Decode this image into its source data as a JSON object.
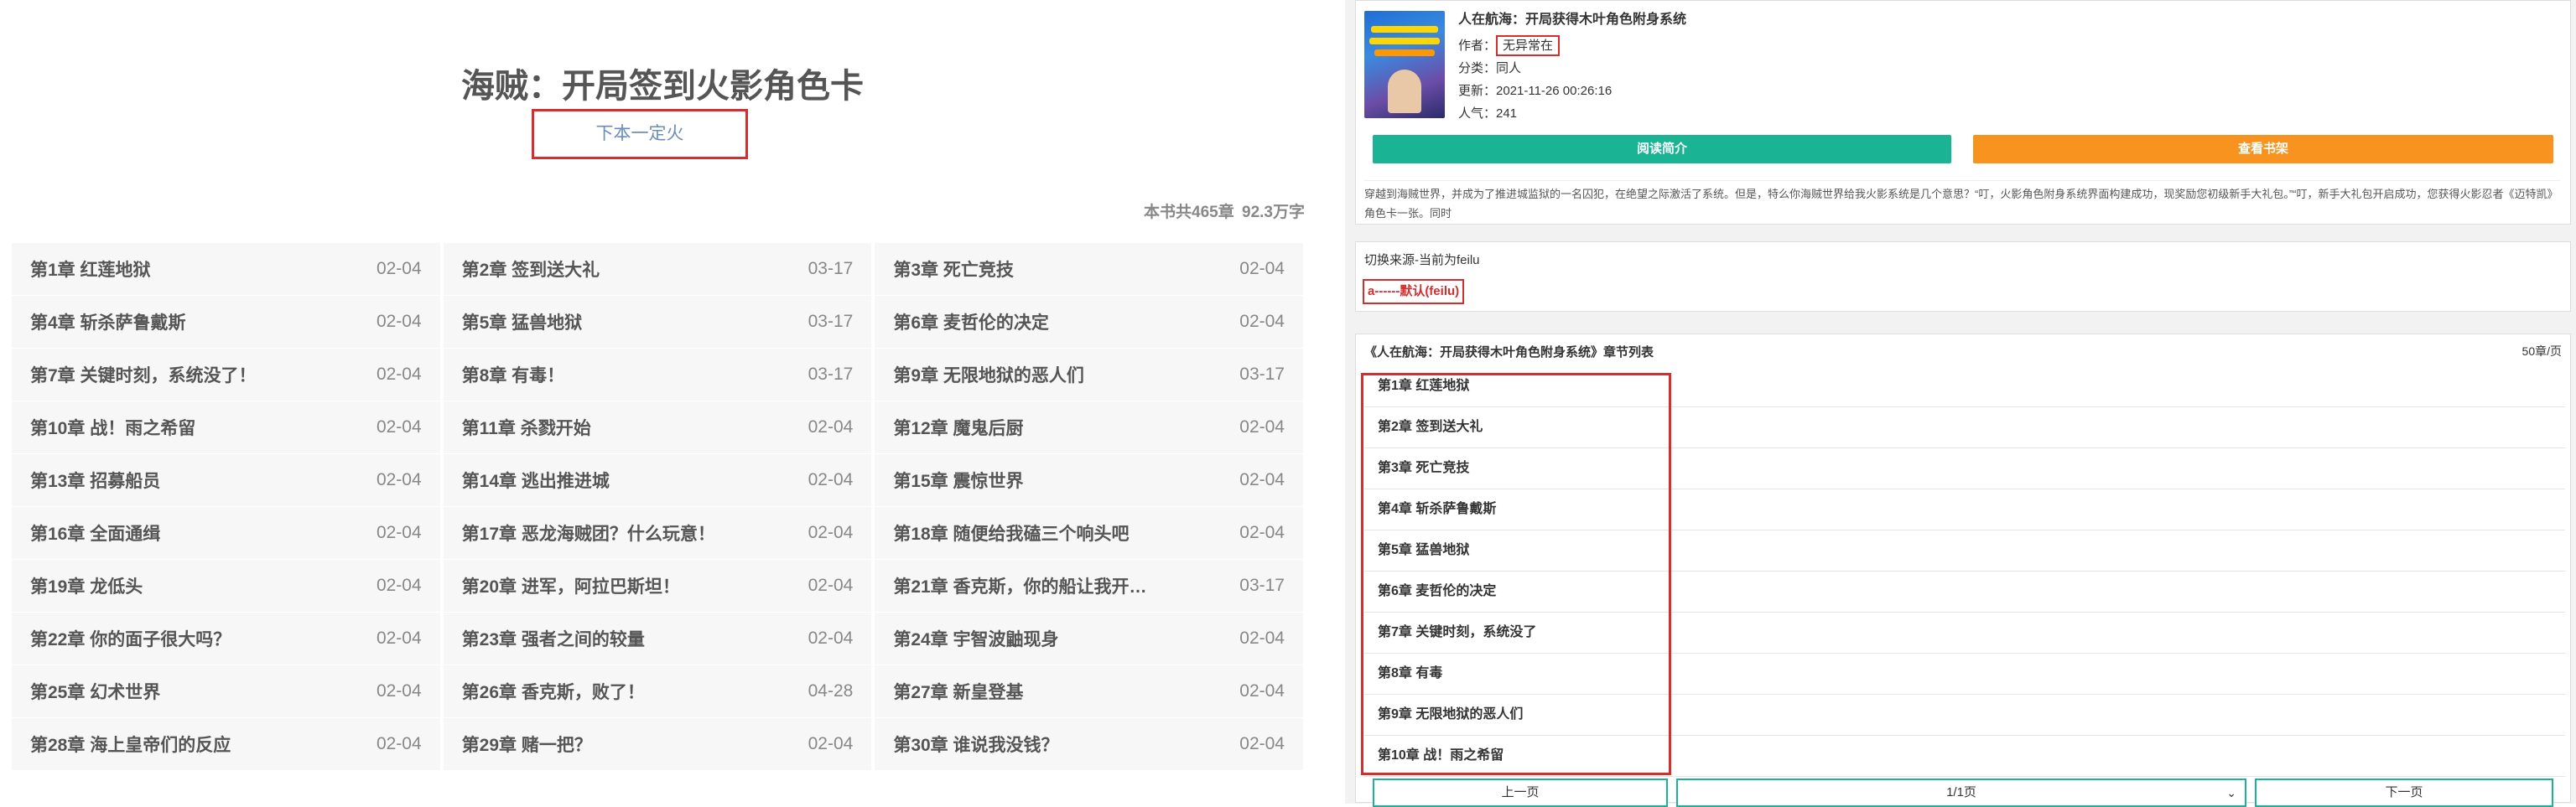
{
  "left": {
    "title": "海贼：开局签到火影角色卡",
    "next_book": "下本一定火",
    "chapter_total": "本书共465章",
    "word_count": "92.3万字",
    "chapters": [
      {
        "title": "第1章 红莲地狱",
        "date": "02-04"
      },
      {
        "title": "第2章 签到送大礼",
        "date": "03-17"
      },
      {
        "title": "第3章 死亡竞技",
        "date": "02-04"
      },
      {
        "title": "第4章 斩杀萨鲁戴斯",
        "date": "02-04"
      },
      {
        "title": "第5章 猛兽地狱",
        "date": "03-17"
      },
      {
        "title": "第6章 麦哲伦的决定",
        "date": "02-04"
      },
      {
        "title": "第7章 关键时刻，系统没了！",
        "date": "02-04"
      },
      {
        "title": "第8章 有毒！",
        "date": "03-17"
      },
      {
        "title": "第9章 无限地狱的恶人们",
        "date": "03-17"
      },
      {
        "title": "第10章 战！雨之希留",
        "date": "02-04"
      },
      {
        "title": "第11章 杀戮开始",
        "date": "02-04"
      },
      {
        "title": "第12章 魔鬼后厨",
        "date": "02-04"
      },
      {
        "title": "第13章 招募船员",
        "date": "02-04"
      },
      {
        "title": "第14章 逃出推进城",
        "date": "02-04"
      },
      {
        "title": "第15章 震惊世界",
        "date": "02-04"
      },
      {
        "title": "第16章 全面通缉",
        "date": "02-04"
      },
      {
        "title": "第17章 恶龙海贼团？什么玩意！",
        "date": "02-04"
      },
      {
        "title": "第18章 随便给我磕三个响头吧",
        "date": "02-04"
      },
      {
        "title": "第19章 龙低头",
        "date": "02-04"
      },
      {
        "title": "第20章 进军，阿拉巴斯坦！",
        "date": "02-04"
      },
      {
        "title": "第21章 香克斯，你的船让我开…",
        "date": "03-17"
      },
      {
        "title": "第22章 你的面子很大吗？",
        "date": "02-04"
      },
      {
        "title": "第23章 强者之间的较量",
        "date": "02-04"
      },
      {
        "title": "第24章 宇智波鼬现身",
        "date": "02-04"
      },
      {
        "title": "第25章 幻术世界",
        "date": "02-04"
      },
      {
        "title": "第26章 香克斯，败了！",
        "date": "04-28"
      },
      {
        "title": "第27章 新皇登基",
        "date": "02-04"
      },
      {
        "title": "第28章 海上皇帝们的反应",
        "date": "02-04"
      },
      {
        "title": "第29章 赌一把？",
        "date": "02-04"
      },
      {
        "title": "第30章 谁说我没钱？",
        "date": "02-04"
      }
    ]
  },
  "right": {
    "book_title": "人在航海：开局获得木叶角色附身系统",
    "author_label": "作者：",
    "author": "无异常在",
    "category": "分类：同人",
    "updated": "更新：2021-11-26 00:26:16",
    "popularity": "人气：241",
    "read_button": "阅读简介",
    "bookmark_button": "查看书架",
    "intro": "穿越到海贼世界，并成为了推进城监狱的一名囚犯，在绝望之际激活了系统。但是，特么你海贼世界给我火影系统是几个意思？“叮，火影角色附身系统界面构建成功，现奖励您初级新手大礼包。”“叮，新手大礼包开启成功，您获得火影忍者《迈特凯》角色卡一张。同时",
    "source_label": "切换来源-当前为feilu",
    "source_option": "a------默认(feilu)",
    "list_header": "《人在航海：开局获得木叶角色附身系统》章节列表",
    "per_page": "50章/页",
    "chapters": [
      "第1章 红莲地狱",
      "第2章 签到送大礼",
      "第3章 死亡竞技",
      "第4章 斩杀萨鲁戴斯",
      "第5章 猛兽地狱",
      "第6章 麦哲伦的决定",
      "第7章 关键时刻，系统没了",
      "第8章 有毒",
      "第9章 无限地狱的恶人们",
      "第10章 战！雨之希留"
    ],
    "prev_page": "上一页",
    "page_select": "1/1页",
    "next_page": "下一页"
  }
}
